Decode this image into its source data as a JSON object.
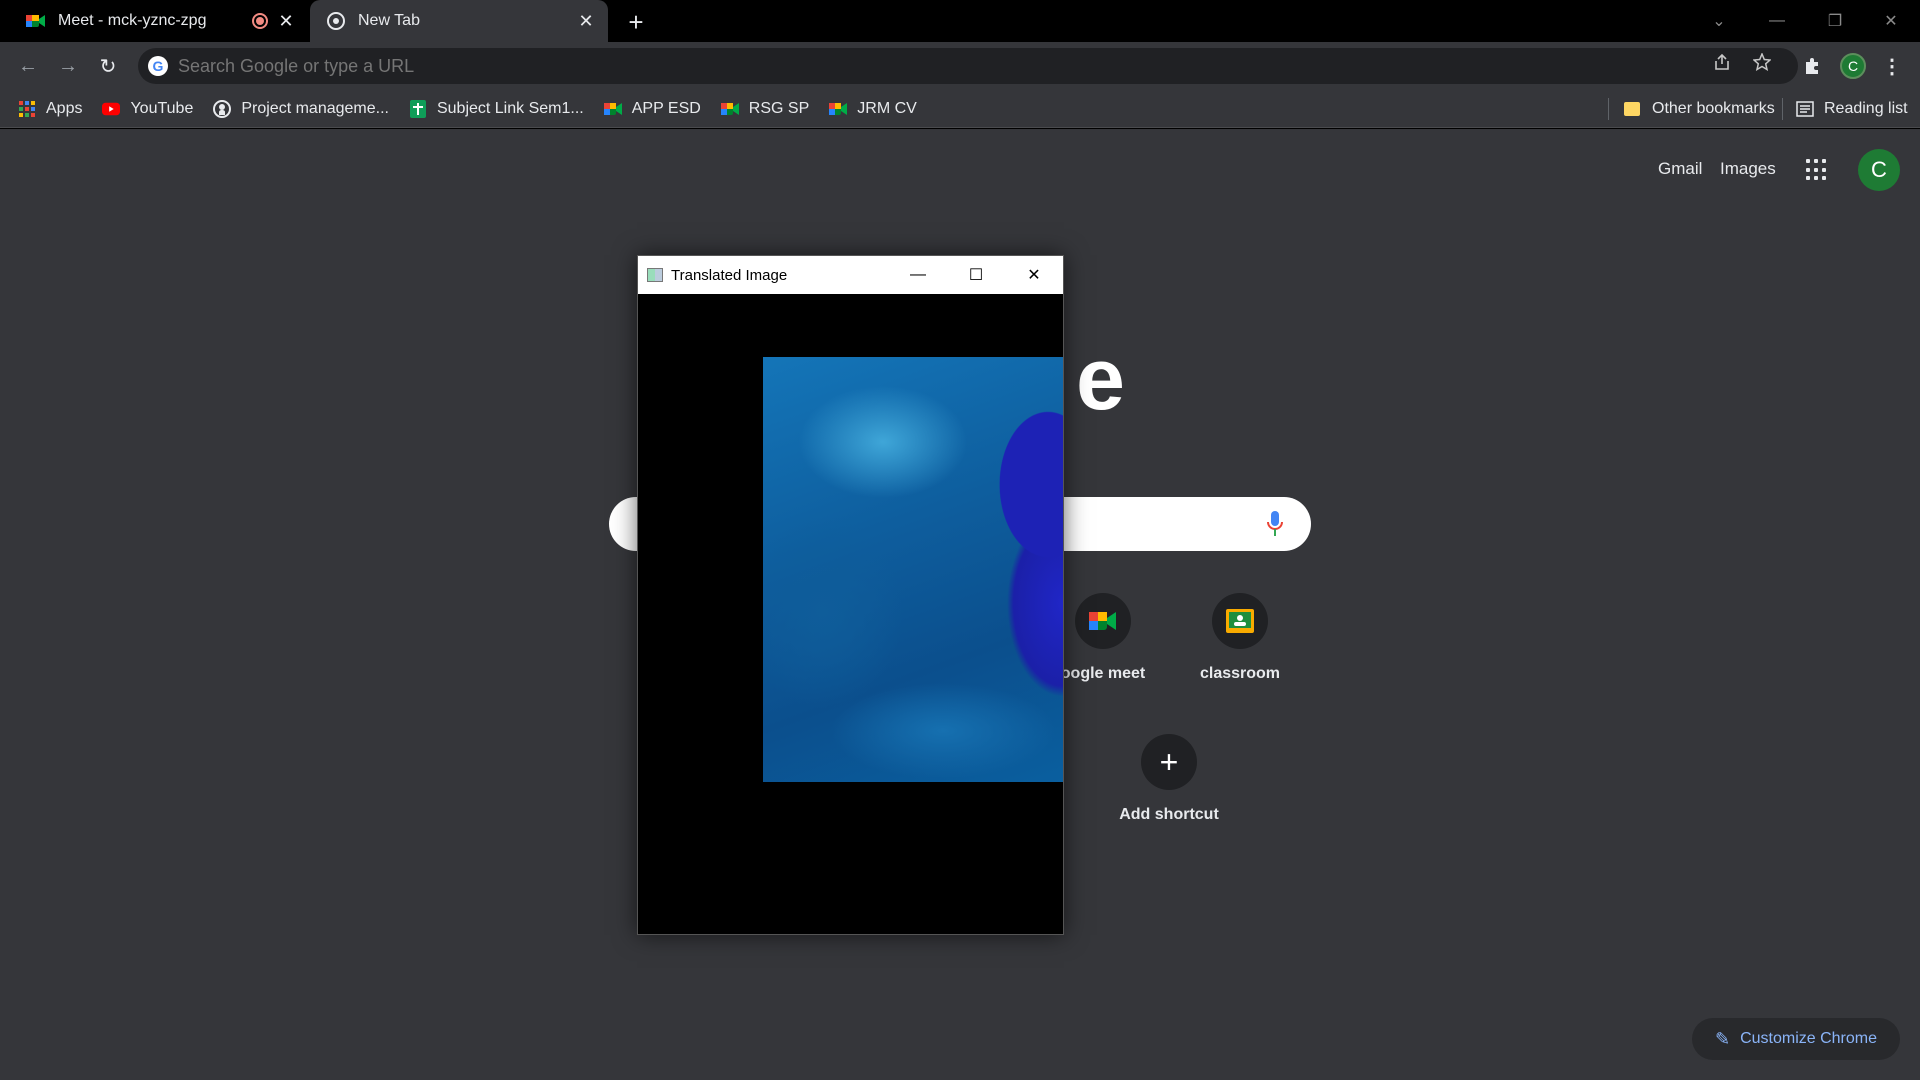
{
  "tabs": [
    {
      "title": "Meet - mck-yznc-zpg",
      "recording": true,
      "icon": "google-meet-icon"
    },
    {
      "title": "New Tab",
      "icon": "chrome-icon"
    }
  ],
  "omnibox": {
    "placeholder": "Search Google or type a URL"
  },
  "bookmarks": {
    "items": [
      {
        "label": "Apps",
        "icon": "apps-grid-icon"
      },
      {
        "label": "YouTube",
        "icon": "youtube-icon"
      },
      {
        "label": "Project manageme...",
        "icon": "github-icon"
      },
      {
        "label": "Subject Link Sem1...",
        "icon": "sheets-icon"
      },
      {
        "label": "APP ESD",
        "icon": "google-meet-icon"
      },
      {
        "label": "RSG SP",
        "icon": "google-meet-icon"
      },
      {
        "label": "JRM CV",
        "icon": "google-meet-icon"
      }
    ],
    "other": "Other bookmarks",
    "reading_list": "Reading list"
  },
  "profile_initial": "C",
  "ntp": {
    "gmail": "Gmail",
    "images": "Images",
    "logo_fragment": "e",
    "shortcuts": [
      {
        "label": "oogle meet",
        "icon": "google-meet-icon"
      },
      {
        "label": "classroom",
        "icon": "classroom-icon"
      },
      {
        "label": "Add shortcut",
        "icon": "plus-icon"
      }
    ],
    "customize": "Customize Chrome"
  },
  "overlay_window": {
    "title": "Translated Image"
  },
  "colors": {
    "accent": "#8ab4f8",
    "profile_green": "#1e7b34"
  }
}
